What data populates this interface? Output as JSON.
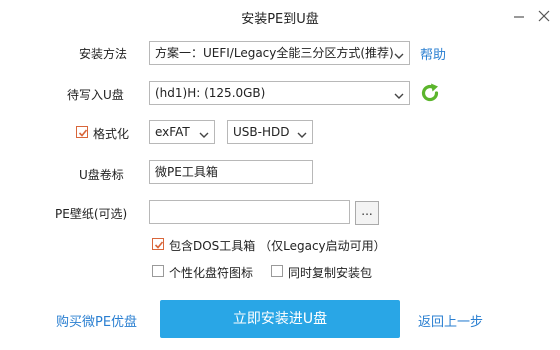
{
  "window": {
    "title": "安装PE到U盘"
  },
  "install_method": {
    "label": "安装方法",
    "selected": "方案一：UEFI/Legacy全能三分区方式(推荐)",
    "help_link": "帮助"
  },
  "target_disk": {
    "label": "待写入U盘",
    "selected": "(hd1)H:  (125.0GB)",
    "refresh_icon": "refresh-icon"
  },
  "format": {
    "checkbox_label": "格式化",
    "checked": true,
    "filesystem": "exFAT",
    "mode": "USB-HDD"
  },
  "volume_label": {
    "label": "U盘卷标",
    "value": "微PE工具箱"
  },
  "wallpaper": {
    "label": "PE壁纸(可选)",
    "value": "",
    "browse_label": "..."
  },
  "options": [
    {
      "label": "包含DOS工具箱 （仅Legacy启动可用）",
      "checked": true
    },
    {
      "label": "个性化盘符图标",
      "checked": false
    },
    {
      "label": "同时复制安装包",
      "checked": false
    }
  ],
  "footer": {
    "buy_link": "购买微PE优盘",
    "install_button": "立即安装进U盘",
    "back_link": "返回上一步"
  },
  "colors": {
    "accent": "#29a6e6",
    "link": "#2a7fd1",
    "refresh": "#5bb52c",
    "checkbox_on": "#d9663a"
  }
}
